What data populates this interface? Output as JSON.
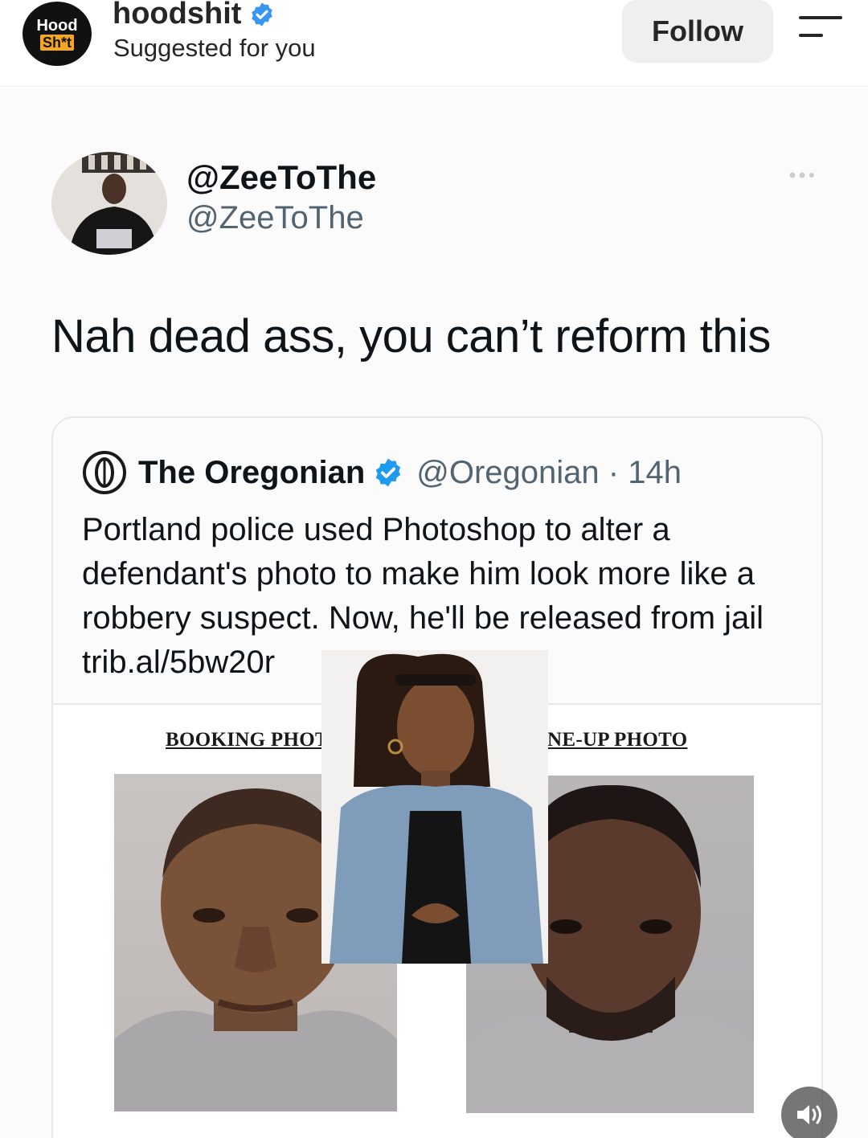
{
  "header": {
    "avatar_line1": "Hood",
    "avatar_line2": "Sh*t",
    "username": "hoodshit",
    "subtitle": "Suggested for you",
    "follow_label": "Follow"
  },
  "tweet": {
    "display_name": "@ZeeToThe",
    "handle": "@ZeeToThe",
    "text": "Nah dead ass, you can’t reform this"
  },
  "quoted_tweet": {
    "name": "The Oregonian",
    "handle_time": "@Oregonian · 14h",
    "text": "Portland police used Photoshop to alter a defendant's photo to make him look more like a robbery suspect. Now, he'll be released from jail trib.al/5bw20r",
    "caption_left": "BOOKING PHOTO",
    "caption_right": "LINE-UP PHOTO"
  },
  "colors": {
    "verified": "#3897f0",
    "text_primary": "#0f1419",
    "text_secondary": "#536471",
    "follow_bg": "#efefef"
  },
  "icons": [
    "verified-badge-icon",
    "menu-icon",
    "more-dots-icon",
    "oregonian-logo-icon",
    "volume-icon"
  ]
}
